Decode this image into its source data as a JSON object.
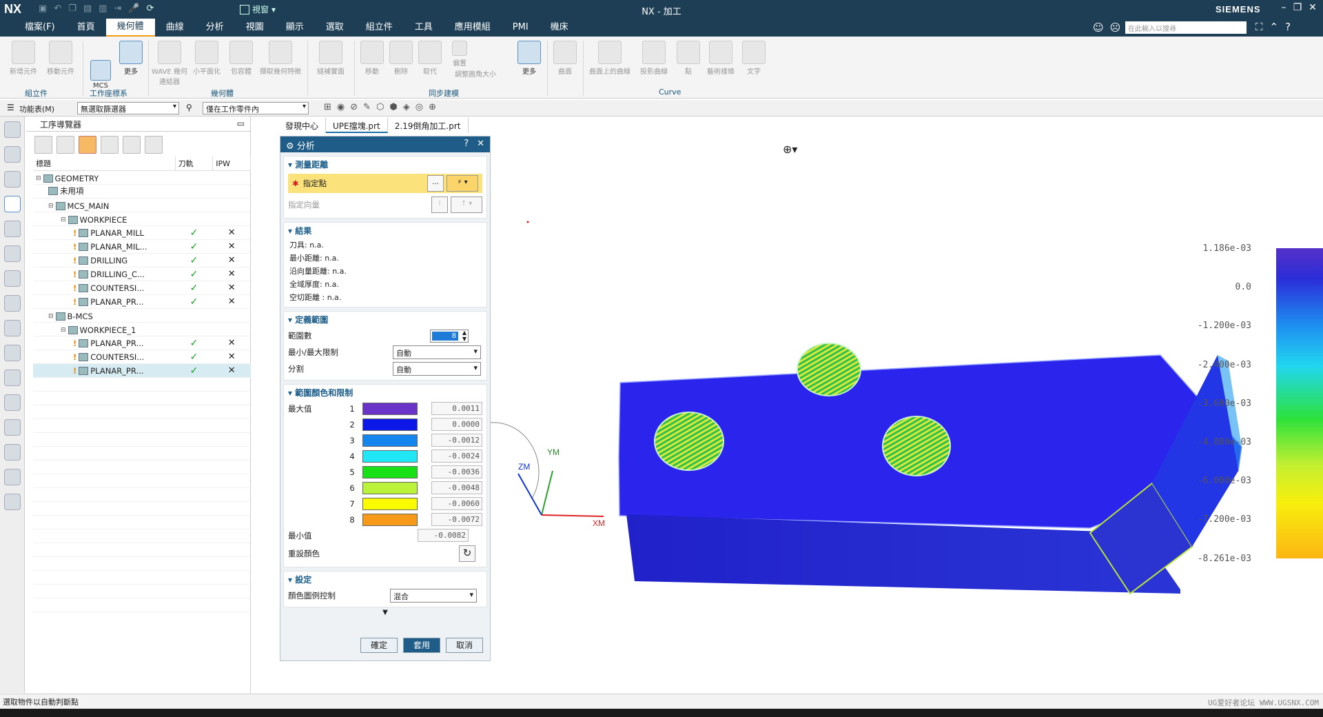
{
  "app": {
    "logo": "NX",
    "title": "NX - 加工",
    "brand": "SIEMENS",
    "view_label": "視窗",
    "window_controls": [
      "–",
      "❐",
      "✕"
    ]
  },
  "menu": {
    "tabs": [
      "檔案(F)",
      "首頁",
      "幾何體",
      "曲線",
      "分析",
      "視圖",
      "顯示",
      "選取",
      "組立件",
      "工具",
      "應用模組",
      "PMI",
      "機床"
    ],
    "active_tab": "幾何體",
    "search_placeholder": "在此輸入以搜尋"
  },
  "ribbon": {
    "buttons": [
      {
        "label": "新增元件",
        "state": "disabled"
      },
      {
        "label": "移動元件",
        "state": "disabled"
      },
      {
        "label": "MCS",
        "state": "on"
      },
      {
        "label": "更多",
        "state": "on"
      },
      {
        "label": "WAVE 幾何連結器",
        "state": "disabled"
      },
      {
        "label": "小平面化",
        "state": "disabled"
      },
      {
        "label": "包容體",
        "state": "disabled"
      },
      {
        "label": "擷取幾何特徵",
        "state": "disabled"
      },
      {
        "label": "縫補實面",
        "state": "disabled"
      },
      {
        "label": "移動",
        "state": "disabled"
      },
      {
        "label": "刪除",
        "state": "disabled"
      },
      {
        "label": "取代",
        "state": "disabled"
      },
      {
        "label": "偏置",
        "state": "disabled"
      },
      {
        "label": "調整圓角大小",
        "state": "disabled"
      },
      {
        "label": "更多",
        "state": "on"
      },
      {
        "label": "曲面",
        "state": "disabled"
      },
      {
        "label": "曲面上的曲線",
        "state": "disabled"
      },
      {
        "label": "投影曲線",
        "state": "disabled"
      },
      {
        "label": "點",
        "state": "disabled"
      },
      {
        "label": "藝術樣條",
        "state": "disabled"
      },
      {
        "label": "文字",
        "state": "disabled"
      }
    ],
    "groups": [
      "組立件",
      "工作座標系",
      "幾何體",
      "同步建模",
      "Curve"
    ]
  },
  "toolbar2": {
    "menu_label": "功能表(M)",
    "filter1": "無選取篩選器",
    "filter2": "僅在工作零件內"
  },
  "navigator": {
    "title": "工序導覽器",
    "columns": [
      "標題",
      "刀軌",
      "IPW"
    ],
    "rows": [
      {
        "name": "GEOMETRY",
        "indent": 0,
        "toolpath": "",
        "ipw": "",
        "selected": false
      },
      {
        "name": "未用項",
        "indent": 1,
        "toolpath": "",
        "ipw": "",
        "selected": false
      },
      {
        "name": "MCS_MAIN",
        "indent": 1,
        "toolpath": "",
        "ipw": "",
        "selected": false
      },
      {
        "name": "WORKPIECE",
        "indent": 2,
        "toolpath": "",
        "ipw": "",
        "selected": false
      },
      {
        "name": "PLANAR_MILL",
        "indent": 3,
        "toolpath": "✓",
        "ipw": "✕",
        "selected": false
      },
      {
        "name": "PLANAR_MIL...",
        "indent": 3,
        "toolpath": "✓",
        "ipw": "✕",
        "selected": false
      },
      {
        "name": "DRILLING",
        "indent": 3,
        "toolpath": "✓",
        "ipw": "✕",
        "selected": false
      },
      {
        "name": "DRILLING_C...",
        "indent": 3,
        "toolpath": "✓",
        "ipw": "✕",
        "selected": false
      },
      {
        "name": "COUNTERSI...",
        "indent": 3,
        "toolpath": "✓",
        "ipw": "✕",
        "selected": false
      },
      {
        "name": "PLANAR_PR...",
        "indent": 3,
        "toolpath": "✓",
        "ipw": "✕",
        "selected": false
      },
      {
        "name": "B-MCS",
        "indent": 1,
        "toolpath": "",
        "ipw": "",
        "selected": false
      },
      {
        "name": "WORKPIECE_1",
        "indent": 2,
        "toolpath": "",
        "ipw": "",
        "selected": false
      },
      {
        "name": "PLANAR_PR...",
        "indent": 3,
        "toolpath": "✓",
        "ipw": "✕",
        "selected": false
      },
      {
        "name": "COUNTERSI...",
        "indent": 3,
        "toolpath": "✓",
        "ipw": "✕",
        "selected": false
      },
      {
        "name": "PLANAR_PR...",
        "indent": 3,
        "toolpath": "✓",
        "ipw": "✕",
        "selected": true
      }
    ]
  },
  "doc_tabs": [
    "發現中心",
    "UPE擋塊.prt",
    "2.19倒角加工.prt"
  ],
  "dialog": {
    "title": "分析",
    "controls": [
      "?",
      "✕"
    ],
    "sections": {
      "measure": {
        "title": "測量距離",
        "specify_point": "指定點",
        "specify_vector": "指定向量"
      },
      "results": {
        "title": "結果",
        "lines": [
          "刀具: n.a.",
          "最小距離: n.a.",
          "沿向量距離: n.a.",
          "全域厚度: n.a.",
          "空切距離 : n.a."
        ]
      },
      "range": {
        "title": "定義範圍",
        "count_label": "範圍數",
        "count_value": "8",
        "minmax_label": "最小/最大限制",
        "minmax_value": "自動",
        "split_label": "分割",
        "split_value": "自動"
      },
      "colors": {
        "title": "範圍顏色和限制",
        "max_label": "最大值",
        "min_label": "最小值",
        "min_value": "-0.0082",
        "reset_label": "重設顏色",
        "items": [
          {
            "n": "1",
            "color": "#6b34c9",
            "value": "0.0011"
          },
          {
            "n": "2",
            "color": "#0b18e8",
            "value": "0.0000"
          },
          {
            "n": "3",
            "color": "#1486ee",
            "value": "-0.0012"
          },
          {
            "n": "4",
            "color": "#1fe7f6",
            "value": "-0.0024"
          },
          {
            "n": "5",
            "color": "#17e017",
            "value": "-0.0036"
          },
          {
            "n": "6",
            "color": "#bbf23a",
            "value": "-0.0048"
          },
          {
            "n": "7",
            "color": "#fafa00",
            "value": "-0.0060"
          },
          {
            "n": "8",
            "color": "#f79a1a",
            "value": "-0.0072"
          }
        ]
      },
      "settings": {
        "title": "設定",
        "legend_label": "顏色圖例控制",
        "legend_value": "混合"
      }
    },
    "buttons": {
      "ok": "確定",
      "apply": "套用",
      "cancel": "取消"
    }
  },
  "viewport": {
    "axis_labels": {
      "xm": "XM",
      "ym": "YM",
      "zm": "ZM"
    },
    "legend_values": [
      "1.186e-03",
      "0.0",
      "-1.200e-03",
      "-2.400e-03",
      "-3.600e-03",
      "-4.800e-03",
      "-6.000e-03",
      "-7.200e-03",
      "-8.261e-03"
    ],
    "legend_xm": "XM"
  },
  "status": {
    "text": "選取物件以自動判斷點",
    "watermark": "UG爱好者论坛 WWW.UGSNX.COM"
  }
}
